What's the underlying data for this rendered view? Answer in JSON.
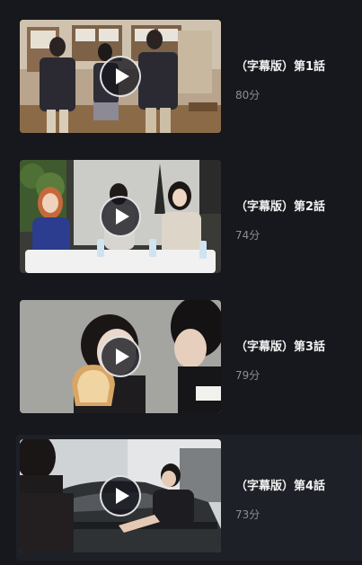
{
  "episodes": [
    {
      "title": "（字幕版）第1話",
      "duration": "80分",
      "scene": "classroom",
      "play_icon": "play-icon"
    },
    {
      "title": "（字幕版）第2話",
      "duration": "74分",
      "scene": "interview",
      "play_icon": "play-icon"
    },
    {
      "title": "（字幕版）第3話",
      "duration": "79分",
      "scene": "toast",
      "play_icon": "play-icon"
    },
    {
      "title": "（字幕版）第4話",
      "duration": "73分",
      "scene": "car",
      "play_icon": "play-icon"
    }
  ],
  "colors": {
    "background": "#16181d",
    "active_row": "#1e2027",
    "title_text": "#f2f2f2",
    "duration_text": "#8b8e96"
  }
}
